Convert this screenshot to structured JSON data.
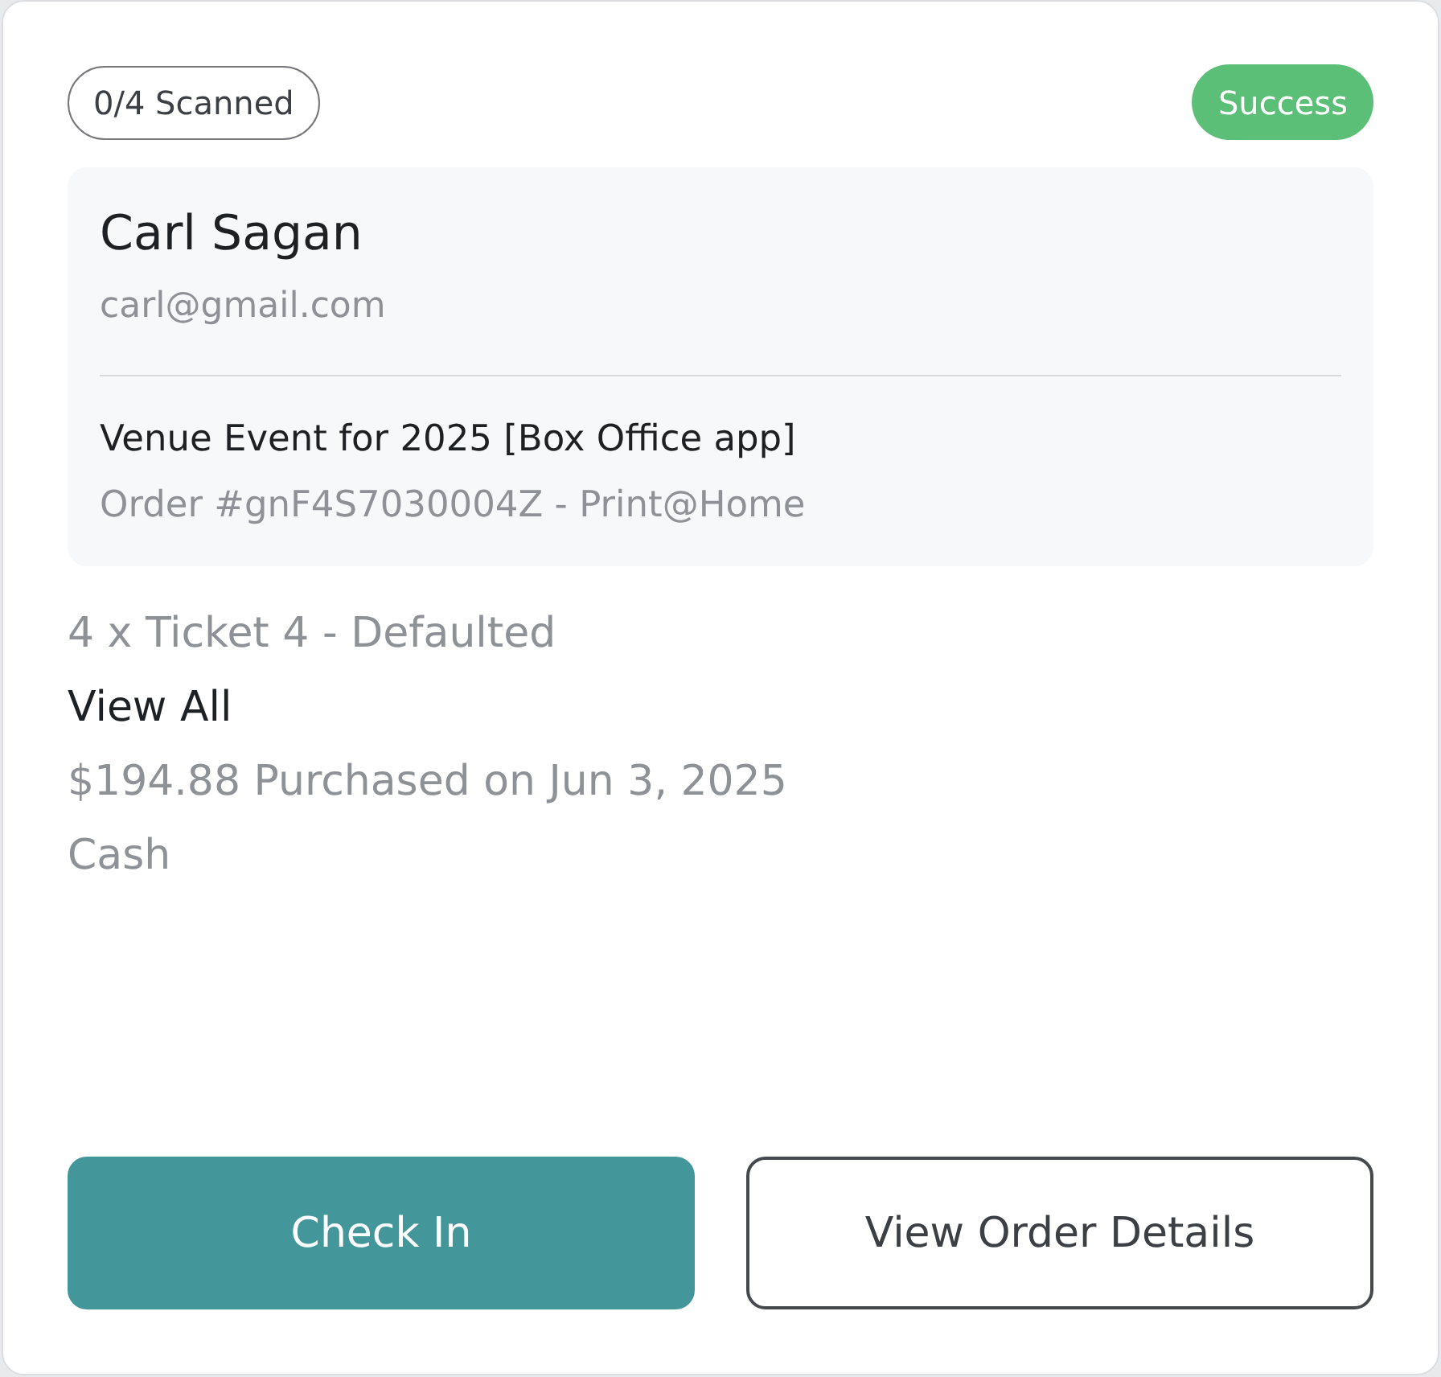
{
  "scan_badge": {
    "label": "0/4 Scanned"
  },
  "status": {
    "label": "Success",
    "kind": "success"
  },
  "customer": {
    "name": "Carl Sagan",
    "email": "carl@gmail.com"
  },
  "event": {
    "title": "Venue Event for 2025 [Box Office app]",
    "order": "Order #gnF4S7030004Z - Print@Home"
  },
  "details": [
    {
      "text": "4 x Ticket 4 - Defaulted",
      "kind": "info"
    },
    {
      "text": "View All",
      "kind": "link"
    },
    {
      "text": "$194.88 Purchased on Jun 3, 2025",
      "kind": "info"
    },
    {
      "text": "Cash",
      "kind": "info"
    }
  ],
  "buttons": [
    {
      "label": "Check In",
      "kind": "primary"
    },
    {
      "label": "View Order Details",
      "kind": "secondary"
    }
  ]
}
